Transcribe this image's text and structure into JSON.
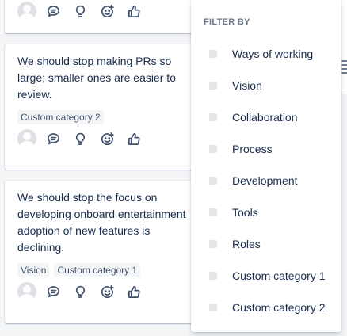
{
  "cards": [
    {
      "text": "",
      "tags": []
    },
    {
      "text": "We should stop making PRs so\nlarge; smaller ones are easier to\nreview.",
      "tags": [
        "Custom category 2"
      ]
    },
    {
      "text_lines": [
        "We should stop the focus on",
        "developing onboard entertainment",
        "adoption of new features is",
        "declining."
      ],
      "tags": [
        "Vision",
        "Custom category 1"
      ]
    }
  ],
  "card_action_icons": [
    "avatar",
    "comment-icon",
    "lightbulb-icon",
    "emoji-add-icon",
    "thumbs-up-icon"
  ],
  "filter_menu": {
    "heading": "FILTER BY",
    "options": [
      "Ways of working",
      "Vision",
      "Collaboration",
      "Process",
      "Development",
      "Tools",
      "Roles",
      "Custom category 1",
      "Custom category 2"
    ]
  },
  "colors": {
    "text": "#172b4d",
    "icon": "#42526e",
    "heading": "#6b778c",
    "tag_bg": "#f4f5f7",
    "checkbox": "#e3e5e9"
  }
}
